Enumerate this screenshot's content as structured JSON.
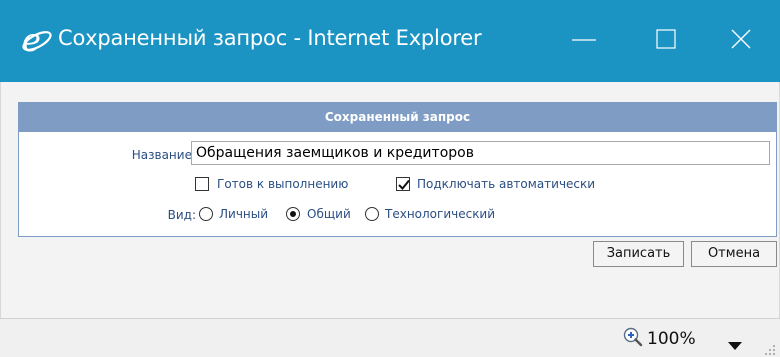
{
  "window": {
    "title": "Сохраненный запрос - Internet Explorer"
  },
  "colors": {
    "titlebar": "#1b93c3",
    "panel_header": "#7f9cc4",
    "label_text": "#2b4f83"
  },
  "dialog": {
    "header": "Сохраненный запрос",
    "name_label": "Название:",
    "name_value": "Обращения заемщиков и кредиторов",
    "checkboxes": [
      {
        "label": "Готов к выполнению",
        "checked": false
      },
      {
        "label": "Подключать автоматически",
        "checked": true
      }
    ],
    "view_label": "Вид:",
    "radios": [
      {
        "label": "Личный",
        "selected": false
      },
      {
        "label": "Общий",
        "selected": true
      },
      {
        "label": "Технологический",
        "selected": false
      }
    ],
    "save_button": "Записать",
    "cancel_button": "Отмена"
  },
  "statusbar": {
    "zoom": "100%"
  }
}
